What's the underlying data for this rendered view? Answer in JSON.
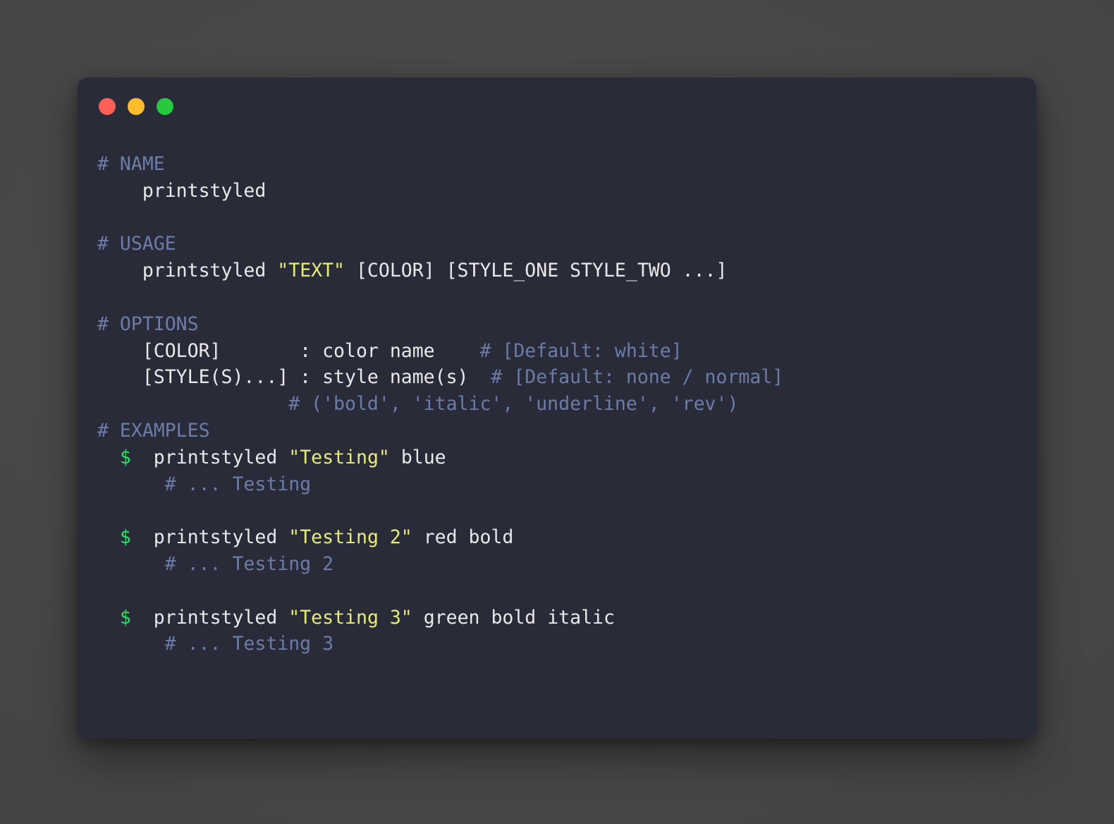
{
  "window": {
    "traffic_lights": [
      {
        "name": "close",
        "color": "#FF5F56"
      },
      {
        "name": "minimize",
        "color": "#FFBD2E"
      },
      {
        "name": "maximize",
        "color": "#27C93F"
      }
    ],
    "background": "#292C38",
    "page_background": "#474747"
  },
  "theme": {
    "text": "#E9E9EB",
    "heading": "#6C7BA8",
    "comment": "#6C7BA8",
    "string": "#E4EC7A",
    "prompt": "#2EE06A"
  },
  "terminal": {
    "sections": {
      "name": {
        "heading": "# NAME",
        "body": "    printstyled"
      },
      "usage": {
        "heading": "# USAGE",
        "command_prefix": "    printstyled ",
        "command_string": "\"TEXT\"",
        "command_suffix": " [COLOR] [STYLE_ONE STYLE_TWO ...]"
      },
      "options": {
        "heading": "# OPTIONS",
        "rows": [
          {
            "param": "    [COLOR]       : color name",
            "gap": "    ",
            "comment": "# [Default: white]"
          },
          {
            "param": "    [STYLE(S)...] : style name(s)",
            "gap": "  ",
            "comment": "# [Default: none / normal]"
          }
        ],
        "styles_note_indent": "                 ",
        "styles_note": "# ('bold', 'italic', 'underline', 'rev')"
      },
      "examples": {
        "heading": "# EXAMPLES",
        "items": [
          {
            "prompt": "$",
            "cmd_prefix": "  printstyled ",
            "cmd_string": "\"Testing\"",
            "cmd_suffix": " blue",
            "output_indent": "      ",
            "output": "# ... Testing"
          },
          {
            "prompt": "$",
            "cmd_prefix": "  printstyled ",
            "cmd_string": "\"Testing 2\"",
            "cmd_suffix": " red bold",
            "output_indent": "      ",
            "output": "# ... Testing 2"
          },
          {
            "prompt": "$",
            "cmd_prefix": "  printstyled ",
            "cmd_string": "\"Testing 3\"",
            "cmd_suffix": " green bold italic",
            "output_indent": "      ",
            "output": "# ... Testing 3"
          }
        ],
        "prompt_indent": "  "
      }
    }
  }
}
